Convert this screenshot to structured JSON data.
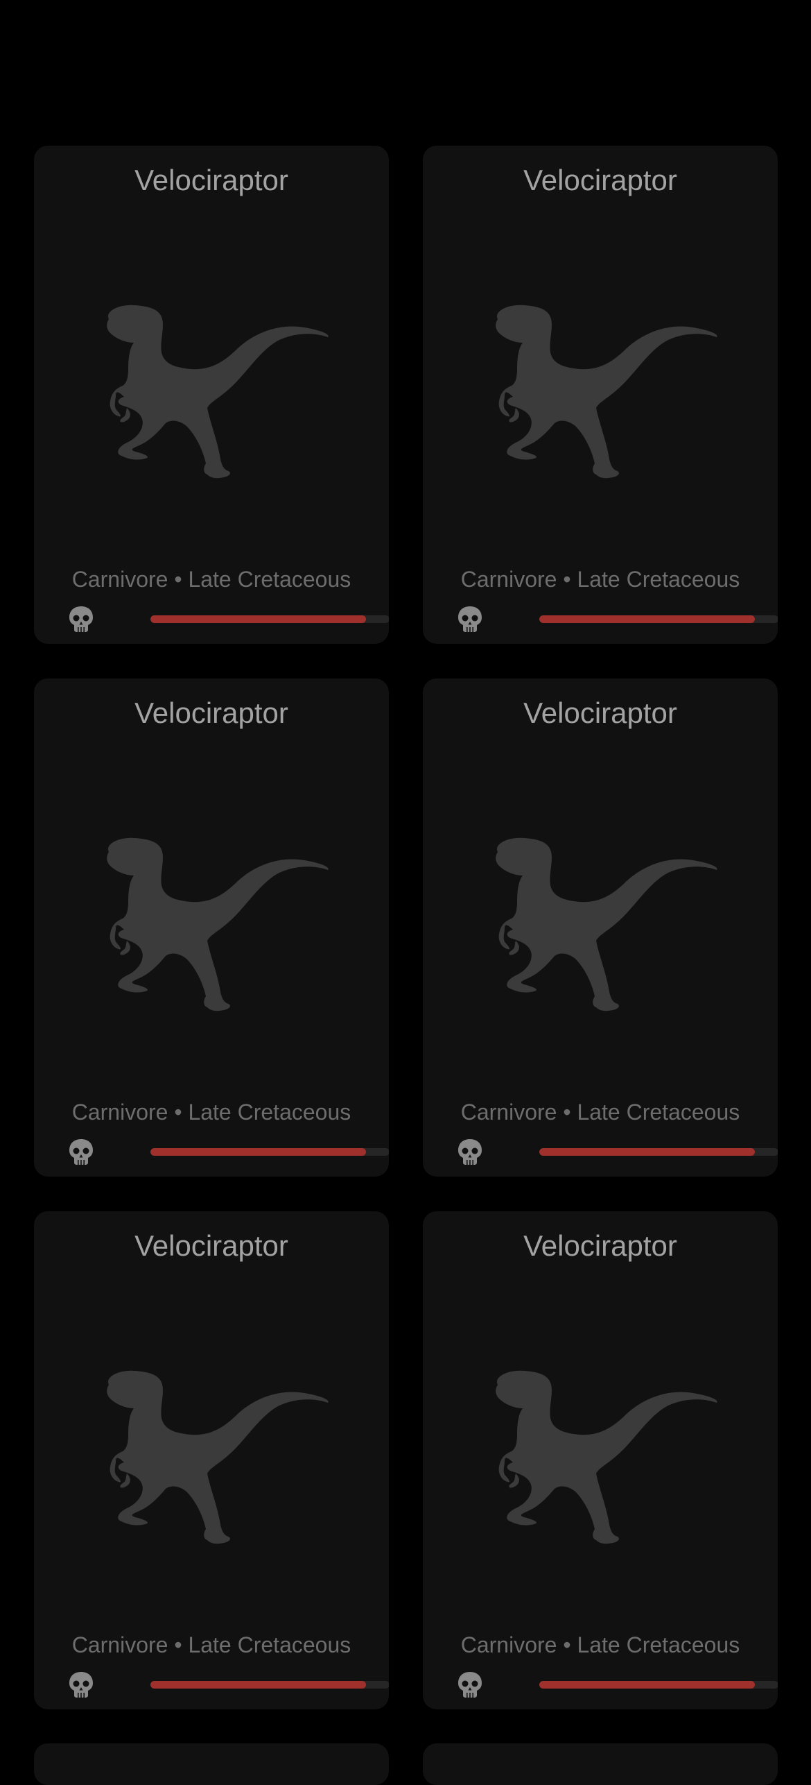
{
  "colors": {
    "background": "#000000",
    "card": "#111111",
    "title": "#a3a3a3",
    "meta": "#6d6d6d",
    "silhouette": "#3b3b3b",
    "danger_fill": "#a0302b",
    "danger_track": "#262626",
    "skull": "#8a8a8a"
  },
  "cards": [
    {
      "name": "Velociraptor",
      "diet": "Carnivore",
      "separator": "•",
      "period": "Late Cretaceous",
      "meta": "Carnivore • Late Cretaceous",
      "icon": "skull-icon",
      "image_icon": "velociraptor-silhouette-icon",
      "danger_level": 0.9
    },
    {
      "name": "Velociraptor",
      "diet": "Carnivore",
      "separator": "•",
      "period": "Late Cretaceous",
      "meta": "Carnivore • Late Cretaceous",
      "icon": "skull-icon",
      "image_icon": "velociraptor-silhouette-icon",
      "danger_level": 0.9
    },
    {
      "name": "Velociraptor",
      "diet": "Carnivore",
      "separator": "•",
      "period": "Late Cretaceous",
      "meta": "Carnivore • Late Cretaceous",
      "icon": "skull-icon",
      "image_icon": "velociraptor-silhouette-icon",
      "danger_level": 0.9
    },
    {
      "name": "Velociraptor",
      "diet": "Carnivore",
      "separator": "•",
      "period": "Late Cretaceous",
      "meta": "Carnivore • Late Cretaceous",
      "icon": "skull-icon",
      "image_icon": "velociraptor-silhouette-icon",
      "danger_level": 0.9
    },
    {
      "name": "Velociraptor",
      "diet": "Carnivore",
      "separator": "•",
      "period": "Late Cretaceous",
      "meta": "Carnivore • Late Cretaceous",
      "icon": "skull-icon",
      "image_icon": "velociraptor-silhouette-icon",
      "danger_level": 0.9
    },
    {
      "name": "Velociraptor",
      "diet": "Carnivore",
      "separator": "•",
      "period": "Late Cretaceous",
      "meta": "Carnivore • Late Cretaceous",
      "icon": "skull-icon",
      "image_icon": "velociraptor-silhouette-icon",
      "danger_level": 0.9
    }
  ]
}
